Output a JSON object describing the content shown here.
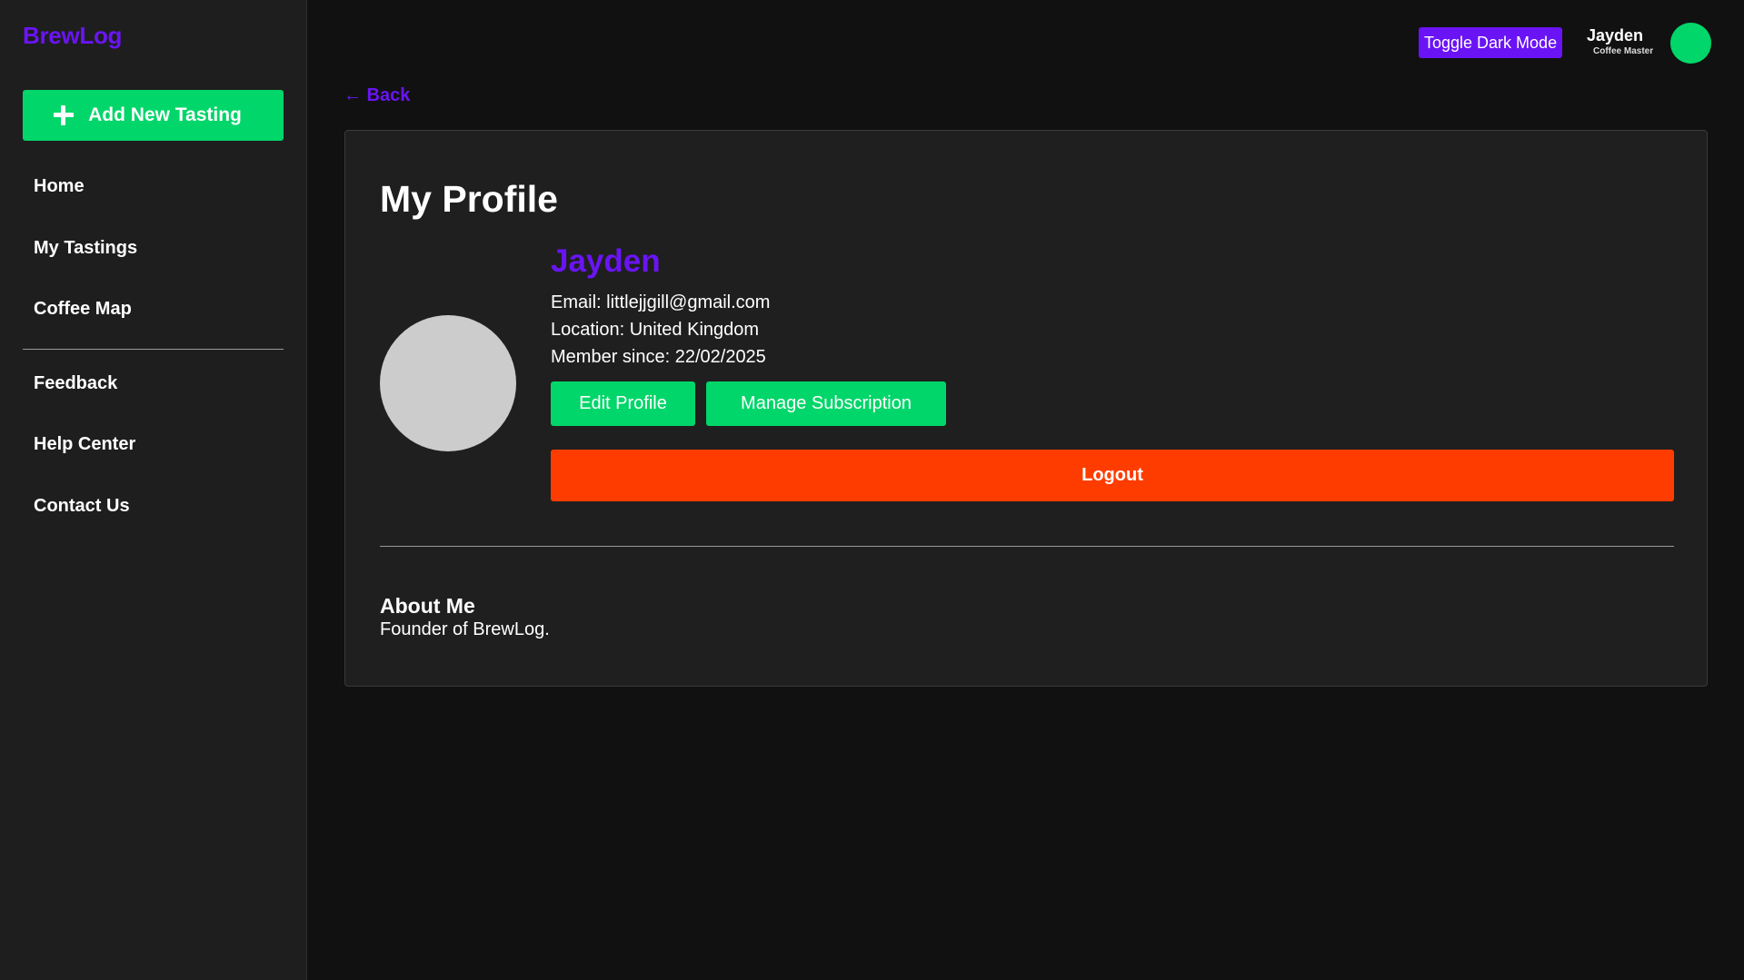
{
  "sidebar": {
    "brand": "BrewLog",
    "add_button_label": "Add New Tasting",
    "nav_primary": [
      "Home",
      "My Tastings",
      "Coffee Map"
    ],
    "nav_secondary": [
      "Feedback",
      "Help Center",
      "Contact Us"
    ]
  },
  "topbar": {
    "toggle_label": "Toggle Dark Mode",
    "user_name": "Jayden",
    "user_role": "Coffee Master"
  },
  "back_label": "← Back",
  "profile": {
    "page_title": "My Profile",
    "name": "Jayden",
    "email_line": "Email: littlejjgill@gmail.com",
    "location_line": "Location: United Kingdom",
    "member_since_line": "Member since: 22/02/2025",
    "edit_label": "Edit Profile",
    "subscription_label": "Manage Subscription",
    "logout_label": "Logout",
    "about_title": "About Me",
    "about_text": "Founder of BrewLog."
  },
  "colors": {
    "accent_purple": "#6a14f5",
    "accent_green": "#00d669",
    "logout_red": "#ff3c00",
    "background": "#111111",
    "sidebar_bg": "#1e1e1e",
    "card_bg": "#1f1f1f",
    "avatar_placeholder": "#cccccc"
  }
}
